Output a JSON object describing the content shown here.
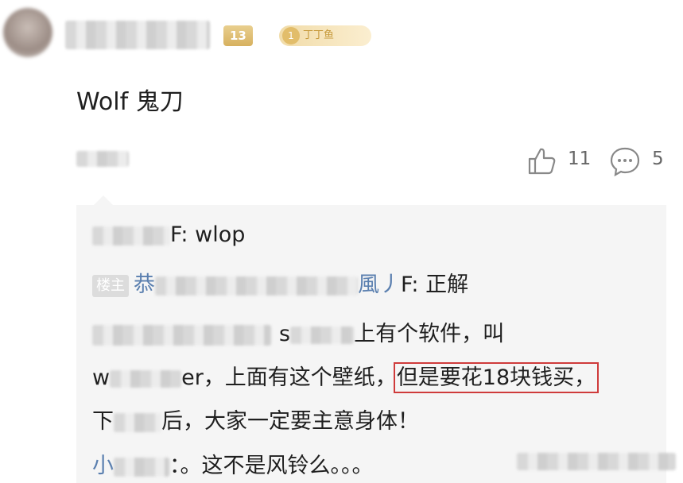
{
  "header": {
    "level_badge": "13",
    "fan_badge_num": "1",
    "fan_badge_text": "丁丁鱼"
  },
  "comment": {
    "text": "Wolf 鬼刀",
    "likes": "11",
    "replies": "5"
  },
  "replies": {
    "r1_suffix": "F: wlop",
    "r2_tag": "楼主",
    "r2_name_start": "恭",
    "r2_name_end": "風丿",
    "r2_suffix": "F: 正解",
    "r3_s": "s",
    "r3_suffix": "上有个软件，叫",
    "r4_prefix": "w",
    "r4_mid": "er，上面有这个壁纸，",
    "r4_highlight": "但是要花18块钱买，",
    "r5_prefix": "下",
    "r5_suffix": "后，大家一定要主意身体！",
    "r6_name": "小",
    "r6_suffix": "：。这不是风铃么。。。"
  }
}
